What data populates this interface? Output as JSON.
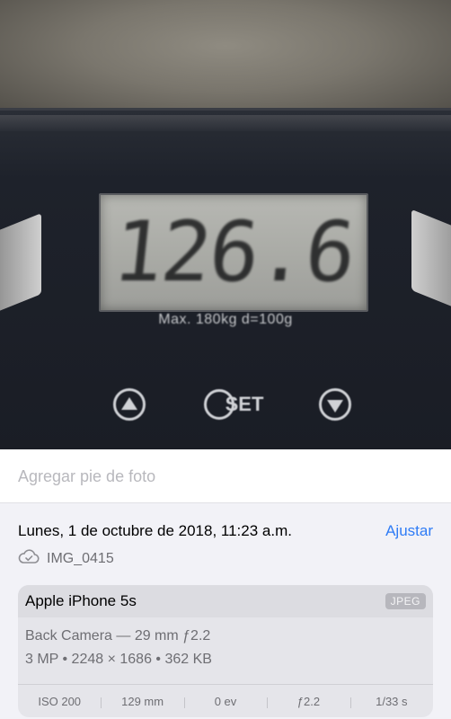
{
  "photo": {
    "display_reading": "126.6",
    "scale_spec": "Max. 180kg d=100g",
    "button_set_label": "SET"
  },
  "caption": {
    "placeholder": "Agregar pie de foto"
  },
  "info": {
    "date": "Lunes, 1 de octubre de 2018, 11:23 a.m.",
    "adjust_label": "Ajustar",
    "file_name": "IMG_0415"
  },
  "device_card": {
    "device": "Apple iPhone 5s",
    "format": "JPEG",
    "camera": "Back Camera — 29 mm ƒ2.2",
    "specs": "3 MP • 2248 × 1686 • 362 KB",
    "exif": [
      "ISO 200",
      "129 mm",
      "0 ev",
      "ƒ2.2",
      "1/33 s"
    ]
  },
  "colors": {
    "accent": "#2f7cf6",
    "secondary_text": "#6e6e73",
    "background": "#f2f2f7"
  },
  "icons": {
    "cloud": "cloud-check-icon",
    "up": "triangle-up-icon",
    "down": "triangle-down-icon"
  }
}
